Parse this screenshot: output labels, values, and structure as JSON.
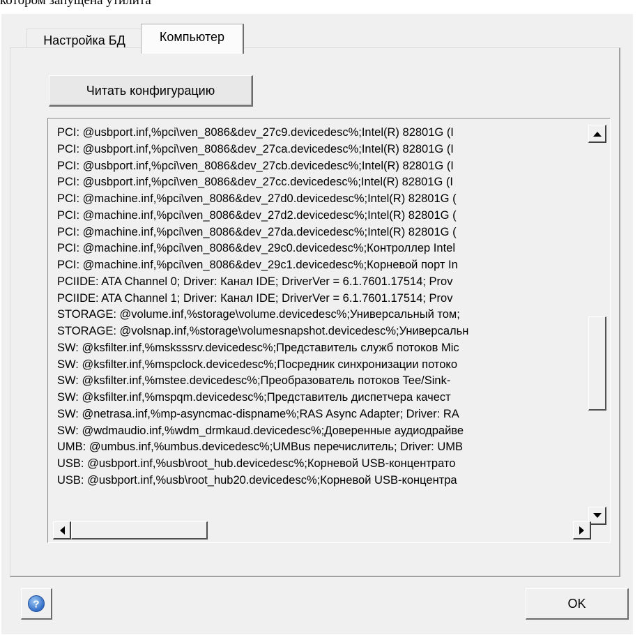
{
  "caption": "котором запущена утилита",
  "tabs": [
    {
      "label": "Настройка БД",
      "active": false
    },
    {
      "label": "Компьютер",
      "active": true
    }
  ],
  "buttons": {
    "read_config": "Читать конфигурацию",
    "ok": "OK",
    "help_icon": "question-mark-circle-icon"
  },
  "device_list": [
    "PCI: @usbport.inf,%pci\\ven_8086&dev_27c9.devicedesc%;Intel(R) 82801G (I",
    "PCI: @usbport.inf,%pci\\ven_8086&dev_27ca.devicedesc%;Intel(R) 82801G (I",
    "PCI: @usbport.inf,%pci\\ven_8086&dev_27cb.devicedesc%;Intel(R) 82801G (I",
    "PCI: @usbport.inf,%pci\\ven_8086&dev_27cc.devicedesc%;Intel(R) 82801G (I",
    "PCI: @machine.inf,%pci\\ven_8086&dev_27d0.devicedesc%;Intel(R) 82801G (",
    "PCI: @machine.inf,%pci\\ven_8086&dev_27d2.devicedesc%;Intel(R) 82801G (",
    "PCI: @machine.inf,%pci\\ven_8086&dev_27da.devicedesc%;Intel(R) 82801G (",
    "PCI: @machine.inf,%pci\\ven_8086&dev_29c0.devicedesc%;Контроллер Intel",
    "PCI: @machine.inf,%pci\\ven_8086&dev_29c1.devicedesc%;Корневой порт In",
    "PCIIDE: ATA Channel 0;  Driver: Канал IDE; DriverVer = 6.1.7601.17514; Prov",
    "PCIIDE: ATA Channel 1;  Driver: Канал IDE; DriverVer = 6.1.7601.17514; Prov",
    "STORAGE: @volume.inf,%storage\\volume.devicedesc%;Универсальный том;",
    "STORAGE: @volsnap.inf,%storage\\volumesnapshot.devicedesc%;Универсальн",
    "SW: @ksfilter.inf,%msksssrv.devicedesc%;Представитель служб потоков Mic",
    "SW: @ksfilter.inf,%mspclock.devicedesc%;Посредник синхронизации потоко",
    "SW: @ksfilter.inf,%mstee.devicedesc%;Преобразователь потоков Tee/Sink-",
    "SW: @ksfilter.inf,%mspqm.devicedesc%;Представитель диспетчера качест",
    "SW: @netrasa.inf,%mp-asyncmac-dispname%;RAS Async Adapter;  Driver: RA",
    "SW: @wdmaudio.inf,%wdm_drmkaud.devicedesc%;Доверенные аудиодрайве",
    "UMB: @umbus.inf,%umbus.devicedesc%;UMBus перечислитель;  Driver: UMB",
    "USB: @usbport.inf,%usb\\root_hub.devicedesc%;Корневой USB-концентрато",
    "USB: @usbport.inf,%usb\\root_hub20.devicedesc%;Корневой USB-концентра"
  ],
  "scrollbar_icons": {
    "up": "arrow-up-icon",
    "down": "arrow-down-icon",
    "left": "arrow-left-icon",
    "right": "arrow-right-icon"
  },
  "colors": {
    "dialog_bg": "#f0f0f0",
    "help_icon": "#3a7bd5"
  }
}
